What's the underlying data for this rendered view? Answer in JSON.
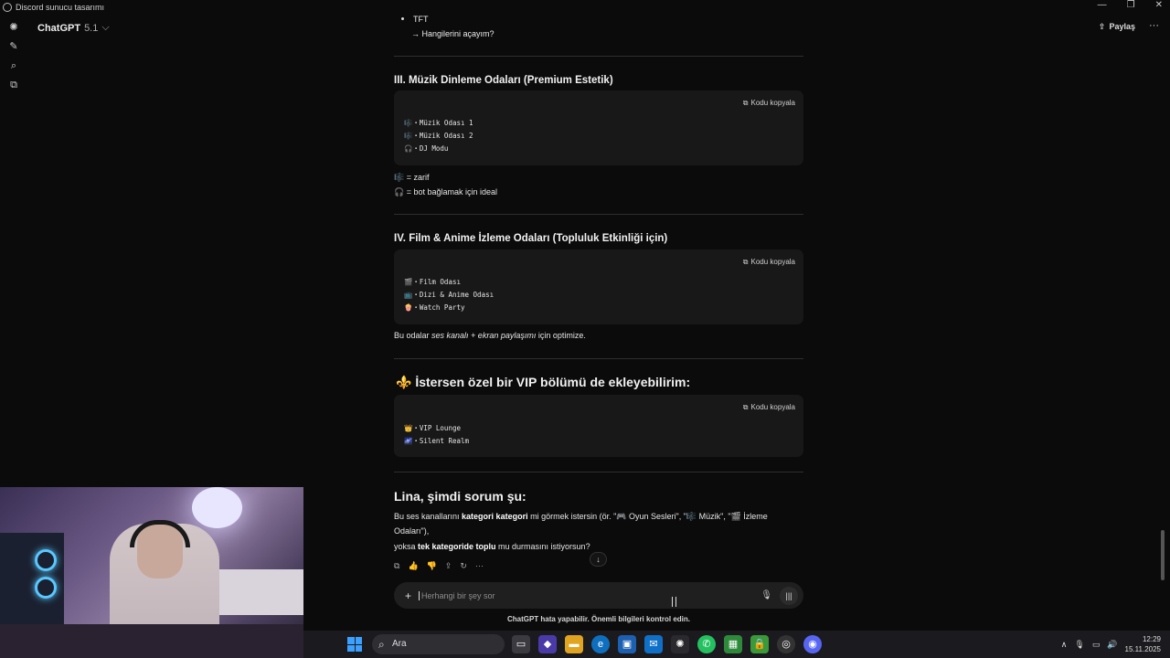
{
  "window": {
    "title": "Discord sunucu tasarımı",
    "controls": [
      "—",
      "❐",
      "✕"
    ]
  },
  "header": {
    "model_name": "ChatGPT",
    "model_version": "5.1",
    "chevron": "⌵",
    "share_label": "Paylaş",
    "more": "···"
  },
  "sidebar": {
    "icons": [
      "new-chat-icon",
      "search-icon",
      "library-icon"
    ]
  },
  "content": {
    "top_bullet": "TFT",
    "top_sub": "→ Hangilerini açayım?",
    "section3": {
      "title": "III. Müzik Dinleme Odaları (Premium Estetik)",
      "copy_label": "Kodu kopyala",
      "lines": [
        "🎼・Müzik Odası 1",
        "🎼・Müzik Odası 2",
        "🎧・DJ Modu"
      ],
      "legend1": "🎼 = zarif",
      "legend2": "🎧 = bot bağlamak için ideal"
    },
    "section4": {
      "title": "IV. Film & Anime İzleme Odaları (Topluluk Etkinliği için)",
      "copy_label": "Kodu kopyala",
      "lines": [
        "🎬・Film Odası",
        "📺・Dizi & Anime Odası",
        "🍿・Watch Party"
      ],
      "note_pre": "Bu odalar ",
      "note_italic": "ses kanalı + ekran paylaşımı",
      "note_post": " için optimize."
    },
    "section5": {
      "icon": "⚜️",
      "title": "İstersen özel bir VIP bölümü de ekleyebilirim:",
      "copy_label": "Kodu kopyala",
      "lines": [
        "👑・VIP Lounge",
        "🌌・Silent Realm"
      ]
    },
    "question": {
      "title": "Lina, şimdi sorum şu:",
      "p1_a": "Bu ses kanallarını ",
      "p1_bold": "kategori kategori",
      "p1_b": " mi görmek istersin (ör. \"🎮 Oyun Sesleri\", \"🎼 Müzik\", \"🎬 İzleme",
      "p1_c": "Odaları\"),",
      "p2_a": "yoksa ",
      "p2_bold": "tek kategoride toplu",
      "p2_b": " mu durmasını istiyorsun?"
    }
  },
  "actions": [
    "⧉",
    "👍",
    "👎",
    "⇪",
    "↻",
    "···"
  ],
  "scroll_down": "↓",
  "composer": {
    "placeholder": "Herhangi bir şey sor",
    "plus": "+",
    "mic": "🎙",
    "voice": "|||"
  },
  "disclaimer": "ChatGPT hata yapabilir. Önemli bilgileri kontrol edin.",
  "taskbar": {
    "search_label": "Ara",
    "apps": [
      "task-view",
      "microsoft-365",
      "file-explorer",
      "edge",
      "store",
      "outlook",
      "chatgpt",
      "whatsapp",
      "minecraft",
      "lock-app",
      "steam",
      "discord"
    ],
    "time": "12:29",
    "date": "15.11.2025"
  }
}
